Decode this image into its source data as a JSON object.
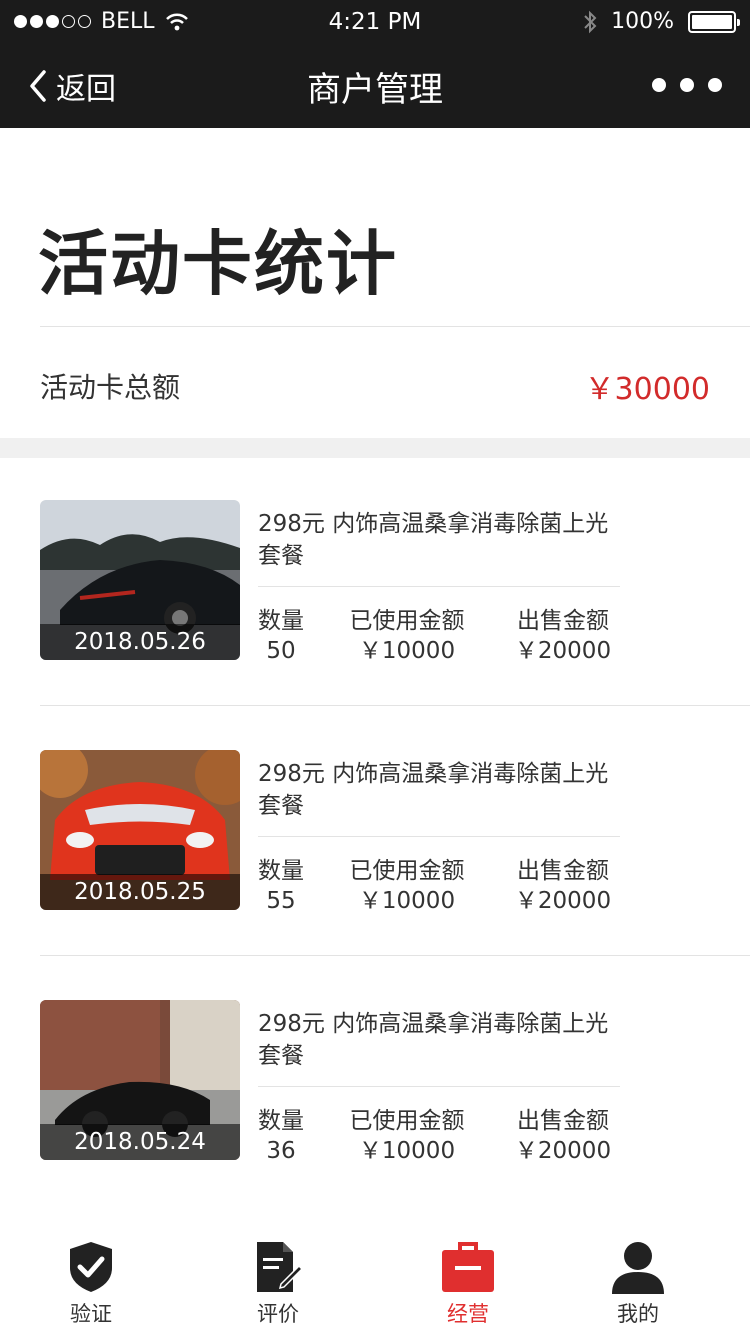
{
  "status_bar": {
    "carrier": "BELL",
    "time": "4:21 PM",
    "battery": "100%"
  },
  "nav": {
    "back_label": "返回",
    "title": "商户管理"
  },
  "page": {
    "title": "活动卡统计",
    "total_label": "活动卡总额",
    "total_value": "￥30000"
  },
  "cards": [
    {
      "date": "2018.05.26",
      "name": "298元 内饰高温桑拿消毒除菌上光套餐",
      "qty_label": "数量",
      "qty": "50",
      "used_label": "已使用金额",
      "used": "￥10000",
      "sold_label": "出售金额",
      "sold": "￥20000"
    },
    {
      "date": "2018.05.25",
      "name": "298元 内饰高温桑拿消毒除菌上光套餐",
      "qty_label": "数量",
      "qty": "55",
      "used_label": "已使用金额",
      "used": "￥10000",
      "sold_label": "出售金额",
      "sold": "￥20000"
    },
    {
      "date": "2018.05.24",
      "name": "298元 内饰高温桑拿消毒除菌上光套餐",
      "qty_label": "数量",
      "qty": "36",
      "used_label": "已使用金额",
      "used": "￥10000",
      "sold_label": "出售金额",
      "sold": "￥20000"
    }
  ],
  "tabbar": {
    "items": [
      {
        "label": "验证",
        "icon": "shield-check-icon"
      },
      {
        "label": "评价",
        "icon": "document-edit-icon"
      },
      {
        "label": "经营",
        "icon": "briefcase-icon",
        "active": true
      },
      {
        "label": "我的",
        "icon": "user-icon"
      }
    ]
  },
  "colors": {
    "nav_bg": "#1b1b1b",
    "accent": "#e02f2f",
    "price": "#d22b2b"
  }
}
